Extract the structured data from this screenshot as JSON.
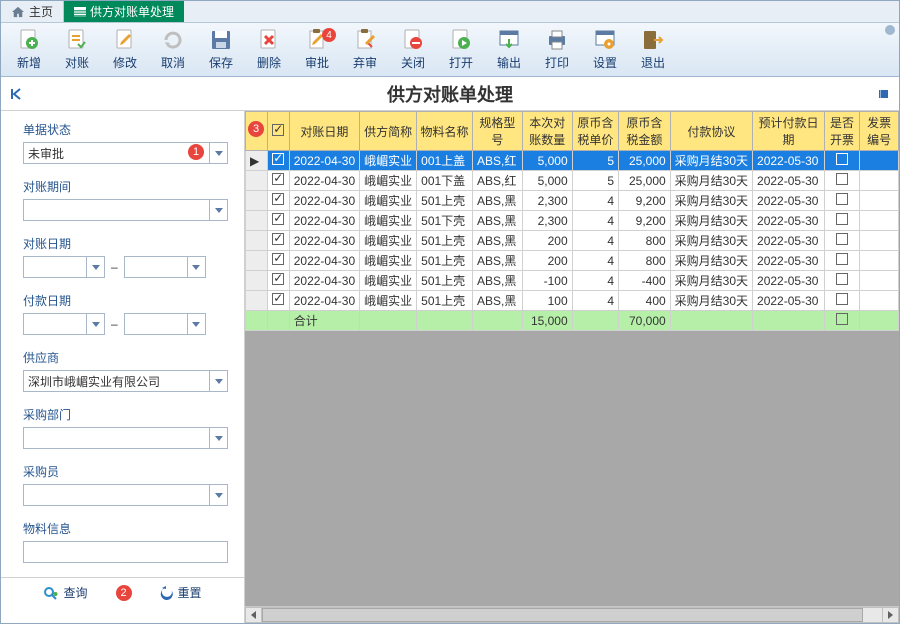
{
  "tabs": {
    "home": "主页",
    "active": "供方对账单处理"
  },
  "toolbar": {
    "items": [
      {
        "id": "new",
        "label": "新增"
      },
      {
        "id": "recon",
        "label": "对账"
      },
      {
        "id": "edit",
        "label": "修改"
      },
      {
        "id": "cancel",
        "label": "取消"
      },
      {
        "id": "save",
        "label": "保存"
      },
      {
        "id": "delete",
        "label": "删除"
      },
      {
        "id": "approve",
        "label": "审批",
        "badge": "4"
      },
      {
        "id": "unapprove",
        "label": "弃审"
      },
      {
        "id": "close",
        "label": "关闭"
      },
      {
        "id": "open",
        "label": "打开"
      },
      {
        "id": "export",
        "label": "输出"
      },
      {
        "id": "print",
        "label": "打印"
      },
      {
        "id": "settings",
        "label": "设置"
      },
      {
        "id": "exit",
        "label": "退出"
      }
    ]
  },
  "title": "供方对账单处理",
  "filters": {
    "status": {
      "label": "单据状态",
      "value": "未审批"
    },
    "period": {
      "label": "对账期间",
      "value": ""
    },
    "recon_date": {
      "label": "对账日期",
      "from": "",
      "to": ""
    },
    "pay_date": {
      "label": "付款日期",
      "from": "",
      "to": ""
    },
    "supplier": {
      "label": "供应商",
      "value": "深圳市峨嵋实业有限公司"
    },
    "dept": {
      "label": "采购部门",
      "value": ""
    },
    "buyer": {
      "label": "采购员",
      "value": ""
    },
    "material": {
      "label": "物料信息",
      "value": ""
    }
  },
  "actions": {
    "query": "查询",
    "reset": "重置"
  },
  "callouts": {
    "c1": "1",
    "c2": "2",
    "c3": "3"
  },
  "grid": {
    "headers": [
      "对账日期",
      "供方简称",
      "物料名称",
      "规格型号",
      "本次对账数量",
      "原币含税单价",
      "原币含税金额",
      "付款协议",
      "预计付款日期",
      "是否开票",
      "发票编号"
    ],
    "rows": [
      {
        "sel": true,
        "date": "2022-04-30",
        "sup": "峨嵋实业",
        "mat": "001上盖",
        "spec": "ABS,红",
        "qty": "5,000",
        "price": "5",
        "amt": "25,000",
        "pay": "采购月结30天",
        "due": "2022-05-30",
        "inv": false,
        "invno": ""
      },
      {
        "date": "2022-04-30",
        "sup": "峨嵋实业",
        "mat": "001下盖",
        "spec": "ABS,红",
        "qty": "5,000",
        "price": "5",
        "amt": "25,000",
        "pay": "采购月结30天",
        "due": "2022-05-30",
        "inv": false,
        "invno": ""
      },
      {
        "date": "2022-04-30",
        "sup": "峨嵋实业",
        "mat": "501上壳",
        "spec": "ABS,黑",
        "qty": "2,300",
        "price": "4",
        "amt": "9,200",
        "pay": "采购月结30天",
        "due": "2022-05-30",
        "inv": false,
        "invno": ""
      },
      {
        "date": "2022-04-30",
        "sup": "峨嵋实业",
        "mat": "501下壳",
        "spec": "ABS,黑",
        "qty": "2,300",
        "price": "4",
        "amt": "9,200",
        "pay": "采购月结30天",
        "due": "2022-05-30",
        "inv": false,
        "invno": ""
      },
      {
        "date": "2022-04-30",
        "sup": "峨嵋实业",
        "mat": "501上壳",
        "spec": "ABS,黑",
        "qty": "200",
        "price": "4",
        "amt": "800",
        "pay": "采购月结30天",
        "due": "2022-05-30",
        "inv": false,
        "invno": ""
      },
      {
        "date": "2022-04-30",
        "sup": "峨嵋实业",
        "mat": "501上壳",
        "spec": "ABS,黑",
        "qty": "200",
        "price": "4",
        "amt": "800",
        "pay": "采购月结30天",
        "due": "2022-05-30",
        "inv": false,
        "invno": ""
      },
      {
        "date": "2022-04-30",
        "sup": "峨嵋实业",
        "mat": "501上壳",
        "spec": "ABS,黑",
        "qty": "-100",
        "price": "4",
        "amt": "-400",
        "pay": "采购月结30天",
        "due": "2022-05-30",
        "inv": false,
        "invno": ""
      },
      {
        "date": "2022-04-30",
        "sup": "峨嵋实业",
        "mat": "501上壳",
        "spec": "ABS,黑",
        "qty": "100",
        "price": "4",
        "amt": "400",
        "pay": "采购月结30天",
        "due": "2022-05-30",
        "inv": false,
        "invno": ""
      }
    ],
    "total": {
      "label": "合计",
      "qty": "15,000",
      "amt": "70,000"
    }
  }
}
